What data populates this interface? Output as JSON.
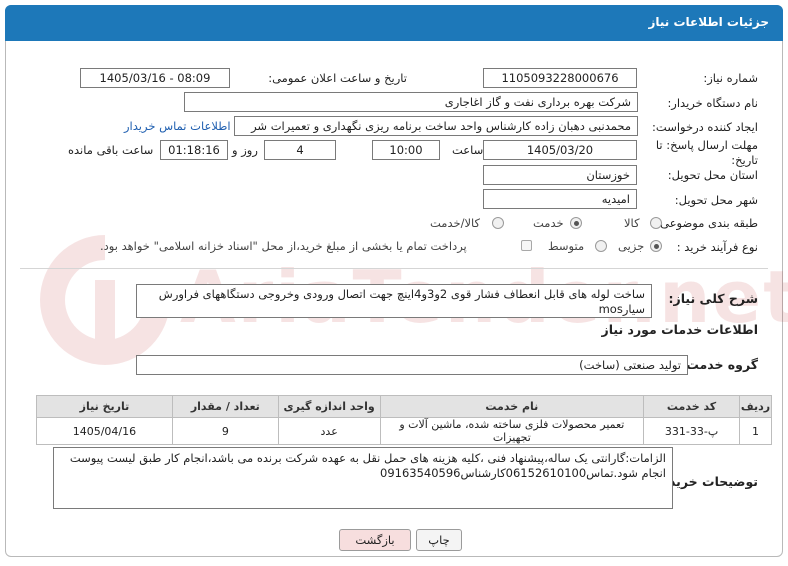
{
  "header": {
    "title": "جزئیات اطلاعات نیاز"
  },
  "watermark": {
    "text": "AriaTender.net"
  },
  "fields": {
    "need_number": {
      "label": "شماره نیاز:",
      "value": "1105093228000676"
    },
    "announce": {
      "label": "تاریخ و ساعت اعلان عمومی:",
      "value": "1405/03/16 - 08:09"
    },
    "buyer": {
      "label": "نام دستگاه خریدار:",
      "value": "شرکت بهره برداری نفت و گاز اغاجاری"
    },
    "creator": {
      "label": "ایجاد کننده درخواست:",
      "value": "محمدنبی دهبان زاده کارشناس واحد ساخت برنامه ریزی نگهداری  و تعمیرات شر",
      "contact_link": "اطلاعات تماس خریدار"
    },
    "deadline": {
      "label_line1": "مهلت ارسال پاسخ: تا",
      "label_line2": "تاریخ:",
      "date": "1405/03/20",
      "time_label": "ساعت",
      "time": "10:00",
      "days": "4",
      "days_label": "روز و",
      "remaining": "01:18:16",
      "remaining_label": "ساعت باقی مانده"
    },
    "province": {
      "label": "استان محل تحویل:",
      "value": "خوزستان"
    },
    "city": {
      "label": "شهر محل تحویل:",
      "value": "امیدیه"
    },
    "category": {
      "label": "طبقه بندی موضوعی:",
      "options": [
        "کالا",
        "خدمت",
        "کالا/خدمت"
      ],
      "selected": "خدمت"
    },
    "process": {
      "label": "نوع فرآیند خرید :",
      "options": [
        "جزیی",
        "متوسط"
      ],
      "selected": "جزیی",
      "payment_note": "پرداخت تمام یا بخشی از مبلغ خرید،از محل \"اسناد خزانه اسلامی\" خواهد بود."
    }
  },
  "summary": {
    "label": "شرح کلی نیاز:",
    "text": "ساخت لوله های قابل انعطاف فشار قوی 2و3و4اینچ جهت اتصال ورودی وخروجی دستگاههای فراورش سیارmos"
  },
  "services": {
    "section_title": "اطلاعات خدمات مورد نیاز",
    "group_label": "گروه خدمت:",
    "group_value": "تولید صنعتی (ساخت)",
    "table": {
      "columns": [
        "ردیف",
        "کد خدمت",
        "نام خدمت",
        "واحد اندازه گیری",
        "تعداد / مقدار",
        "تاریخ نیاز"
      ],
      "rows": [
        [
          "1",
          "پ-33-331",
          "تعمیر محصولات فلزی ساخته شده، ماشین آلات و تجهیزات",
          "عدد",
          "9",
          "1405/04/16"
        ]
      ]
    }
  },
  "buyer_notes": {
    "label": "توضیحات خریدار:",
    "text": "الزامات:گارانتی یک ساله،پیشنهاد فنی ،کلیه هزینه های حمل نقل به عهده شرکت برنده می باشد،انجام کار طبق لیست پیوست انجام شود.تماس06152610100کارشناس09163540596"
  },
  "buttons": {
    "print": "چاپ",
    "back": "بازگشت"
  },
  "colors": {
    "header": "#1d78b9",
    "link": "#1f5fb0",
    "back_button": "#f7dede"
  }
}
